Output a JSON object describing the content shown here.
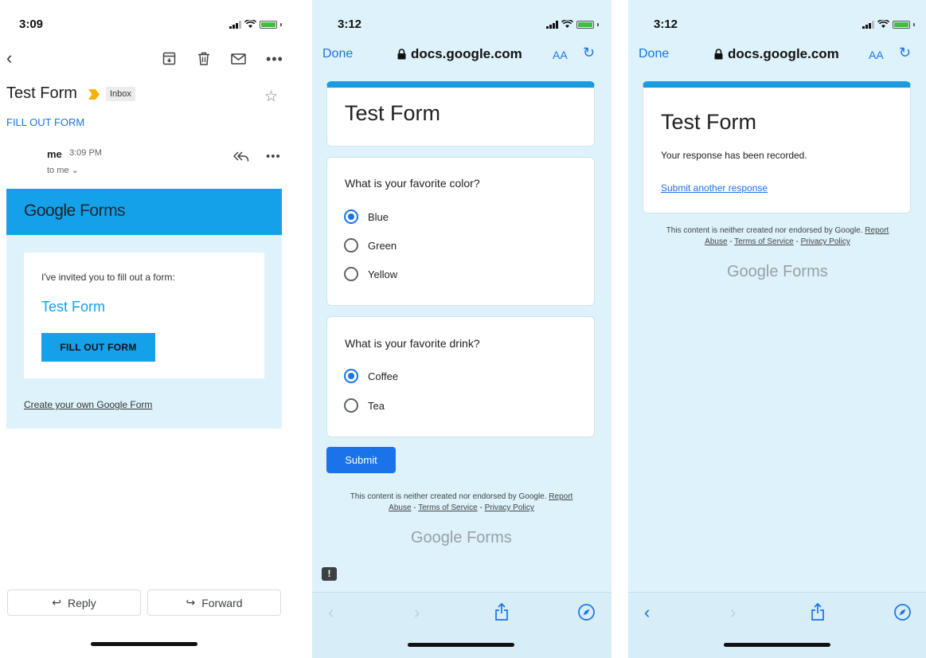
{
  "gmail": {
    "status_time": "3:09",
    "subject": "Test Form",
    "inbox_label": "Inbox",
    "fill_link": "FILL OUT FORM",
    "sender": "me",
    "sent_time": "3:09 PM",
    "to_me": "to me",
    "banner_logo_google": "Google",
    "banner_logo_forms": "Forms",
    "invite_text": "I've invited you to fill out a form:",
    "form_title": "Test Form",
    "fill_button": "FILL OUT FORM",
    "create_link": "Create your own Google Form",
    "reply_label": "Reply",
    "forward_label": "Forward",
    "icons": {
      "back": "back-chevron-icon",
      "archive": "archive-icon",
      "trash": "trash-icon",
      "mail": "mail-icon",
      "more": "more-icon",
      "star": "star-icon",
      "reply_all": "reply-all-icon",
      "label_marker": "important-marker-icon"
    },
    "colors": {
      "banner": "#14a1ea",
      "button": "#14a1ea",
      "link": "#1a73e8",
      "marker": "#f4b400"
    }
  },
  "form": {
    "status_time": "3:12",
    "done": "Done",
    "url": "docs.google.com",
    "aa": "AA",
    "title": "Test Form",
    "q1": "What is your favorite color?",
    "q1_options": [
      "Blue",
      "Green",
      "Yellow"
    ],
    "q1_selected": "Blue",
    "q2": "What is your favorite drink?",
    "q2_options": [
      "Coffee",
      "Tea"
    ],
    "q2_selected": "Coffee",
    "submit": "Submit",
    "disclaimer": "This content is neither created nor endorsed by Google.",
    "report": "Report",
    "abuse": "Abuse",
    "terms": "Terms of Service",
    "privacy": "Privacy Policy",
    "logo_google": "Google",
    "logo_forms": "Forms"
  },
  "confirm": {
    "status_time": "3:12",
    "done": "Done",
    "url": "docs.google.com",
    "aa": "AA",
    "title": "Test Form",
    "recorded": "Your response has been recorded.",
    "another": "Submit another response",
    "disclaimer": "This content is neither created nor endorsed by Google.",
    "report": "Report",
    "abuse": "Abuse",
    "terms": "Terms of Service",
    "privacy": "Privacy Policy",
    "logo_google": "Google",
    "logo_forms": "Forms"
  }
}
